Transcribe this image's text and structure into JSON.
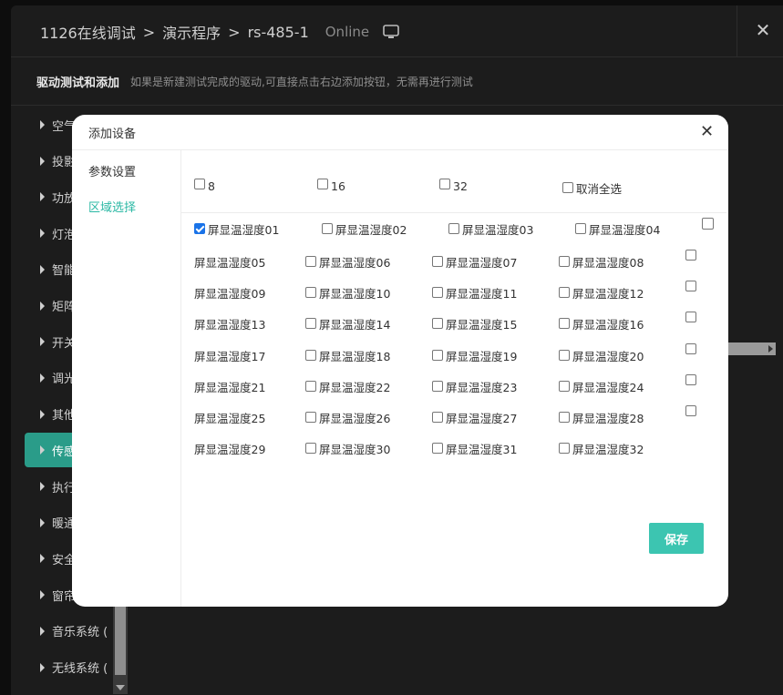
{
  "breadcrumb": {
    "project": "1126在线调试",
    "program": "演示程序",
    "device": "rs-485-1",
    "status": "Online"
  },
  "subheader": {
    "title": "驱动测试和添加",
    "hint": "如果是新建测试完成的驱动,可直接点击右边添加按钮，无需再进行测试"
  },
  "categories": [
    "空气",
    "投影",
    "功放",
    "灯泡",
    "智能",
    "矩阵",
    "开关",
    "调光",
    "其他",
    "传感",
    "执行",
    "暖通",
    "安全",
    "窗帘",
    "音乐系统 (",
    "无线系统 ("
  ],
  "active_category": "传感",
  "modal": {
    "title": "添加设备",
    "close": "✕",
    "tabs": [
      "参数设置",
      "区域选择"
    ],
    "active_tab": "区域选择",
    "select_options": [
      "8",
      "16",
      "32",
      "取消全选"
    ],
    "devices": [
      "屏显温湿度01",
      "屏显温湿度02",
      "屏显温湿度03",
      "屏显温湿度04",
      "屏显温湿度05",
      "屏显温湿度06",
      "屏显温湿度07",
      "屏显温湿度08",
      "屏显温湿度09",
      "屏显温湿度10",
      "屏显温湿度11",
      "屏显温湿度12",
      "屏显温湿度13",
      "屏显温湿度14",
      "屏显温湿度15",
      "屏显温湿度16",
      "屏显温湿度17",
      "屏显温湿度18",
      "屏显温湿度19",
      "屏显温湿度20",
      "屏显温湿度21",
      "屏显温湿度22",
      "屏显温湿度23",
      "屏显温湿度24",
      "屏显温湿度25",
      "屏显温湿度26",
      "屏显温湿度27",
      "屏显温湿度28",
      "屏显温湿度29",
      "屏显温湿度30",
      "屏显温湿度31",
      "屏显温湿度32"
    ],
    "checked": [
      "屏显温湿度01"
    ],
    "save_label": "保存"
  },
  "colors": {
    "accent": "#2a9c89",
    "button": "#3cc5b1",
    "tab_active": "#2bb8a4",
    "checkbox": "#1a73e8"
  },
  "window_close": "✕"
}
